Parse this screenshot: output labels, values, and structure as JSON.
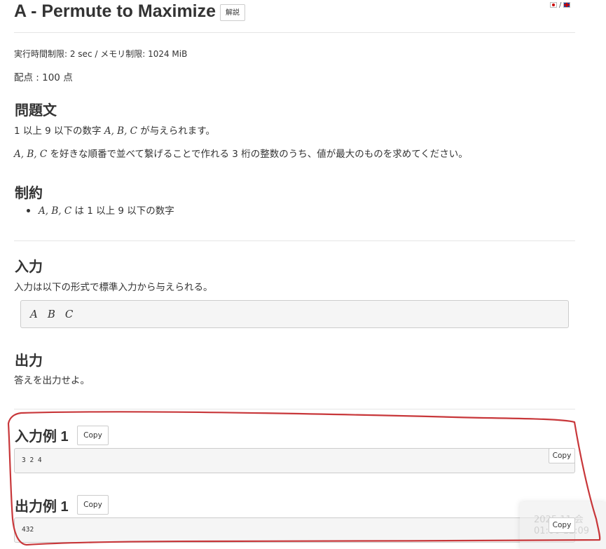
{
  "header": {
    "title": "A - Permute to Maximize",
    "editorial_label": "解説",
    "lang_separator": "/"
  },
  "limits": {
    "text": "実行時間制限: 2 sec / メモリ制限: 1024 MiB"
  },
  "score": {
    "text": "配点 : 100 点"
  },
  "statement": {
    "heading": "問題文",
    "line1_prefix": "1 以上 9 以下の数字 ",
    "vars": "A, B, C",
    "line1_suffix": " が与えられます。",
    "line2_suffix": " を好きな順番で並べて繋げることで作れる 3 桁の整数のうち、値が最大のものを求めてください。"
  },
  "constraints": {
    "heading": "制約",
    "item_suffix": " は 1 以上 9 以下の数字"
  },
  "input": {
    "heading": "入力",
    "text": "入力は以下の形式で標準入力から与えられる。",
    "format": [
      "A",
      "B",
      "C"
    ]
  },
  "output": {
    "heading": "出力",
    "text": "答えを出力せよ。"
  },
  "samples": {
    "input_heading": "入力例 1",
    "input_value": "3 2 4",
    "output_heading": "出力例 1",
    "output_value": "432",
    "copy_label": "Copy"
  },
  "toast": {
    "line1": "2025 11 会",
    "line2": "01:00 12:09"
  },
  "colors": {
    "annotation": "#c8373a"
  }
}
